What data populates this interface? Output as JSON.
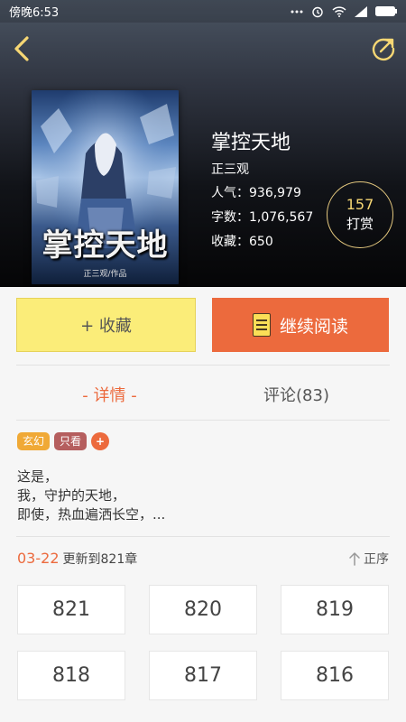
{
  "status_bar": {
    "time": "傍晚6:53",
    "icons": [
      "more-dots-icon",
      "alarm-icon",
      "wifi-icon",
      "signal-icon",
      "battery-icon"
    ]
  },
  "header": {
    "back_icon": "chevron-left-icon",
    "share_icon": "share-icon"
  },
  "book": {
    "cover_title_art": "掌控天地",
    "cover_byline": "正三观/作品",
    "title": "掌控天地",
    "author": "正三观",
    "popularity_label": "人气：",
    "popularity": "936,979",
    "word_count_label": "字数：",
    "word_count": "1,076,567",
    "favorites_label": "收藏：",
    "favorites": "650"
  },
  "reward": {
    "count": "157",
    "label": "打赏"
  },
  "actions": {
    "favorite_label": "+ 收藏",
    "read_label": "继续阅读"
  },
  "tabs": {
    "detail": "- 详情 -",
    "comments": "评论(83)"
  },
  "tags": [
    "玄幻",
    "只看",
    "+"
  ],
  "synopsis": [
    "这是，",
    "我，守护的天地，",
    "即使，热血遍洒长空，..."
  ],
  "update": {
    "date": "03-22",
    "text": "更新到821章",
    "sort_label": "正序"
  },
  "chapters": [
    "821",
    "820",
    "819",
    "818",
    "817",
    "816"
  ],
  "colors": {
    "accent": "#ec6a3d",
    "favorite_button": "#fbed79",
    "reward_count": "#f6d774"
  }
}
